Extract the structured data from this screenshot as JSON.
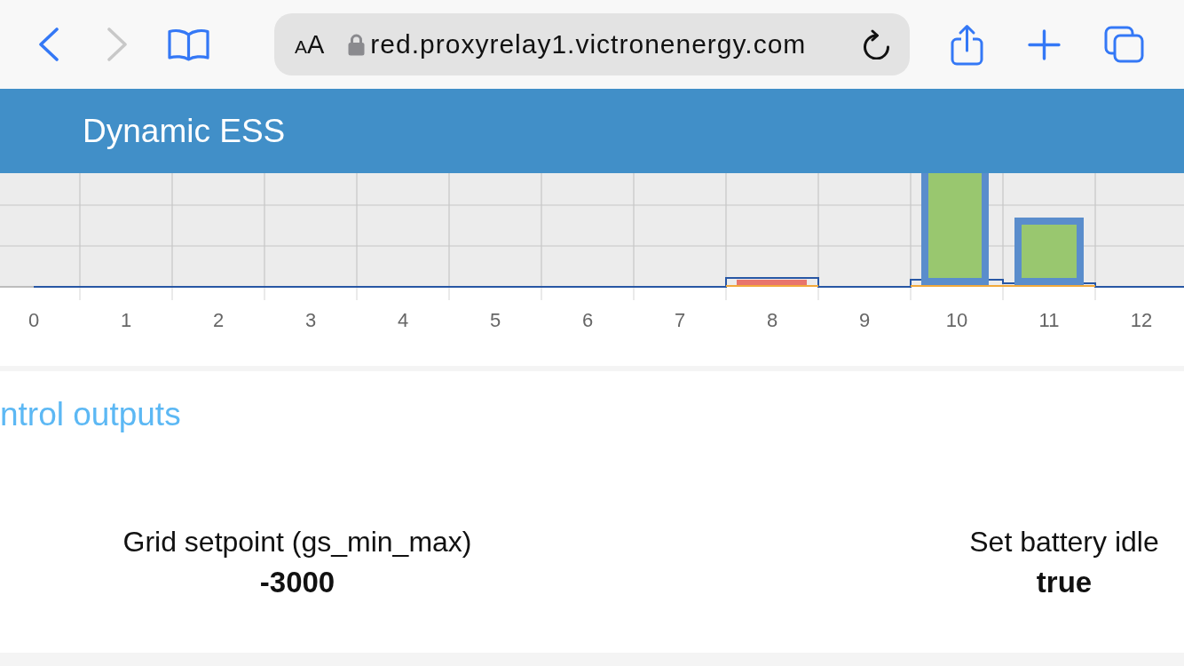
{
  "browser": {
    "back": {
      "disabled": false
    },
    "forward": {
      "disabled": true
    },
    "address_bar": {
      "format_letters": [
        "A",
        "A"
      ],
      "secure": true,
      "url": "red.proxyrelay1.victronenergy.com"
    }
  },
  "header": {
    "title": "Dynamic ESS"
  },
  "chart": {
    "x_ticks": [
      "0",
      "1",
      "2",
      "3",
      "4",
      "5",
      "6",
      "7",
      "8",
      "9",
      "10",
      "11",
      "12"
    ]
  },
  "control_outputs": {
    "heading": "ntrol outputs",
    "items": [
      {
        "label": "Grid setpoint (gs_min_max)",
        "value": "-3000"
      },
      {
        "label": "Set battery idle",
        "value": "true"
      }
    ]
  }
}
